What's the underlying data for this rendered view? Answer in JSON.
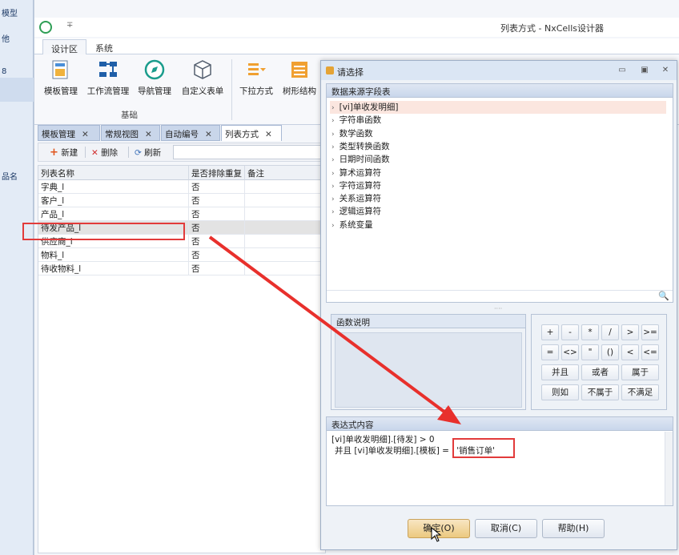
{
  "bg_window": {
    "items": [
      "模型",
      "他",
      "8",
      "品名"
    ]
  },
  "window": {
    "title": "列表方式 - NxCells设计器",
    "quick_access": "∓"
  },
  "ribbon": {
    "tabs": [
      "设计区",
      "系统"
    ],
    "buttons": [
      "模板管理",
      "工作流管理",
      "导航管理",
      "自定义表单",
      "下拉方式",
      "树形结构"
    ],
    "group_label": "基础"
  },
  "doc_tabs": [
    "模板管理",
    "常规视图",
    "自动编号",
    "列表方式"
  ],
  "toolbar": {
    "new": "新建",
    "delete": "删除",
    "refresh": "刷新"
  },
  "grid": {
    "headers": [
      "列表名称",
      "是否排除重复",
      "备注"
    ],
    "rows": [
      {
        "name": "字典_l",
        "dedupe": "否",
        "note": ""
      },
      {
        "name": "客户_l",
        "dedupe": "否",
        "note": ""
      },
      {
        "name": "产品_l",
        "dedupe": "否",
        "note": ""
      },
      {
        "name": "待发产品_l",
        "dedupe": "否",
        "note": ""
      },
      {
        "name": "供应商_l",
        "dedupe": "否",
        "note": ""
      },
      {
        "name": "物料_l",
        "dedupe": "否",
        "note": ""
      },
      {
        "name": "待收物料_l",
        "dedupe": "否",
        "note": ""
      }
    ],
    "selected_row_index": 3
  },
  "dialog": {
    "title": "请选择",
    "datasource_header": "数据来源字段表",
    "tree_items": [
      "[vi]单收发明细]",
      "字符串函数",
      "数学函数",
      "类型转换函数",
      "日期时间函数",
      "算术运算符",
      "字符运算符",
      "关系运算符",
      "逻辑运算符",
      "系统变量"
    ],
    "func_desc_header": "函数说明",
    "calc_buttons": [
      "+",
      "-",
      "*",
      "/",
      ">",
      ">=",
      "=",
      "<>",
      "\"",
      "()",
      "<",
      "<=",
      "并且",
      "或者",
      "属于",
      "则如",
      "不属于",
      "不满足"
    ],
    "expr_header": "表达式内容",
    "expr_line1": "[vi]单收发明细].[待发] > 0",
    "expr_line2_prefix": "并且 [vi]单收发明细].[模板] =",
    "expr_line2_value": "'销售订单'",
    "ok": "确定(O)",
    "cancel": "取消(C)",
    "help": "帮助(H)"
  },
  "colors": {
    "accent_red": "#e23b3b",
    "selection_bg": "#fbe6df"
  }
}
